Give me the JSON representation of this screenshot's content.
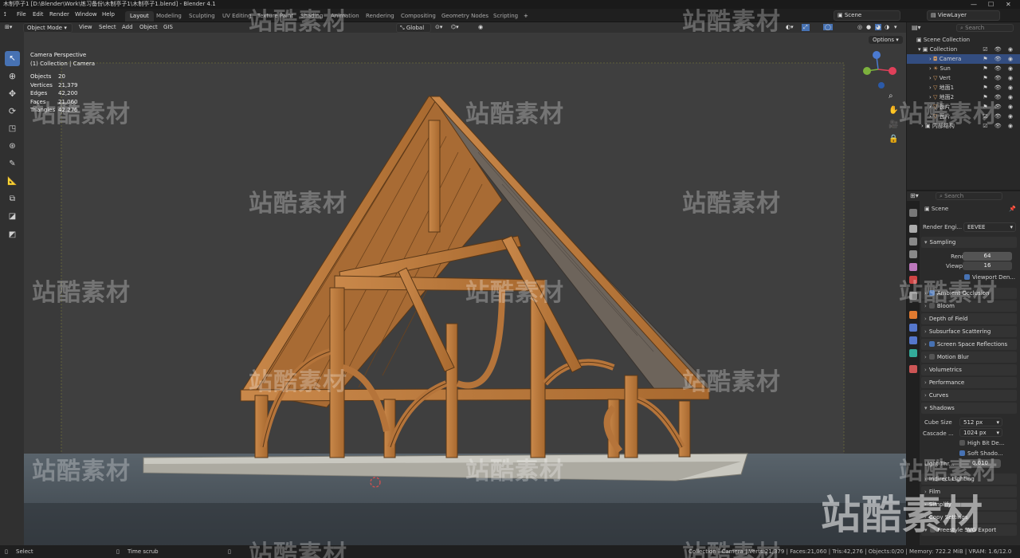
{
  "titlebar": {
    "text": "木制亭子1 [D:\\Blender\\Work\\练习备份\\木制亭子1\\木制亭子1.blend] - Blender 4.1"
  },
  "menu": {
    "items": [
      "File",
      "Edit",
      "Render",
      "Window",
      "Help"
    ]
  },
  "workspaces": {
    "tabs": [
      "Layout",
      "Modeling",
      "Sculpting",
      "UV Editing",
      "Texture Paint",
      "Shading",
      "Animation",
      "Rendering",
      "Compositing",
      "Geometry Nodes",
      "Scripting"
    ],
    "active": "Layout",
    "add": "+"
  },
  "scene_selector": {
    "value": "Scene"
  },
  "viewlayer_selector": {
    "value": "ViewLayer"
  },
  "header": {
    "mode": "Object Mode",
    "view": "View",
    "select": "Select",
    "add": "Add",
    "object": "Object",
    "gis": "GIS",
    "transform": "Global",
    "options": "Options"
  },
  "viewport": {
    "title": "Camera Perspective",
    "subtitle": "(1) Collection | Camera",
    "stats": [
      {
        "label": "Objects",
        "value": "20"
      },
      {
        "label": "Vertices",
        "value": "21,379"
      },
      {
        "label": "Edges",
        "value": "42,200"
      },
      {
        "label": "Faces",
        "value": "21,060"
      },
      {
        "label": "Triangles",
        "value": "42,276"
      }
    ]
  },
  "outliner": {
    "search_placeholder": "Search",
    "root": "Scene Collection",
    "collection": "Collection",
    "items": [
      "Camera",
      "Sun",
      "Vert",
      "地面1",
      "地面2",
      "瓦片",
      "瓦片"
    ],
    "extra": "内部结构"
  },
  "properties": {
    "search_placeholder": "Search",
    "scene": "Scene",
    "render_engine_label": "Render Engi...",
    "render_engine": "EEVEE",
    "sampling": "Sampling",
    "render_label": "Render",
    "render_value": "64",
    "viewport_label": "Viewport",
    "viewport_value": "16",
    "viewport_denoise": "Viewport Den...",
    "sections": [
      "Ambient Occlusion",
      "Bloom",
      "Depth of Field",
      "Subsurface Scattering",
      "Screen Space Reflections",
      "Motion Blur",
      "Volumetrics",
      "Performance",
      "Curves"
    ],
    "shadows": "Shadows",
    "cube_size_label": "Cube Size",
    "cube_size": "512 px",
    "cascade_label": "Cascade ...",
    "cascade": "1024 px",
    "high_bit": "High Bit De...",
    "soft_shadows": "Soft Shado...",
    "light_threshold_label": "Light Thr...",
    "light_threshold": "0.010",
    "after_sections": [
      "Indirect Lighting",
      "Film",
      "Simplify",
      "Copy Settings",
      "Freestyle SVG Export"
    ]
  },
  "statusbar": {
    "left": "Select",
    "middle": "Time scrub",
    "right": "Collection | Camera | Verts:21,379 | Faces:21,060 | Tris:42,276 | Objects:0/20 | Memory: 722.2 MiB | VRAM: 1.6/12.0 GiB | 4.1.1"
  },
  "watermark": {
    "text": "站酷素材"
  },
  "colors": {
    "accent": "#4772b3",
    "wood": "#b9773f",
    "wood_dark": "#7a4a22",
    "roof": "#6b6158",
    "ground": "#4a5055"
  }
}
